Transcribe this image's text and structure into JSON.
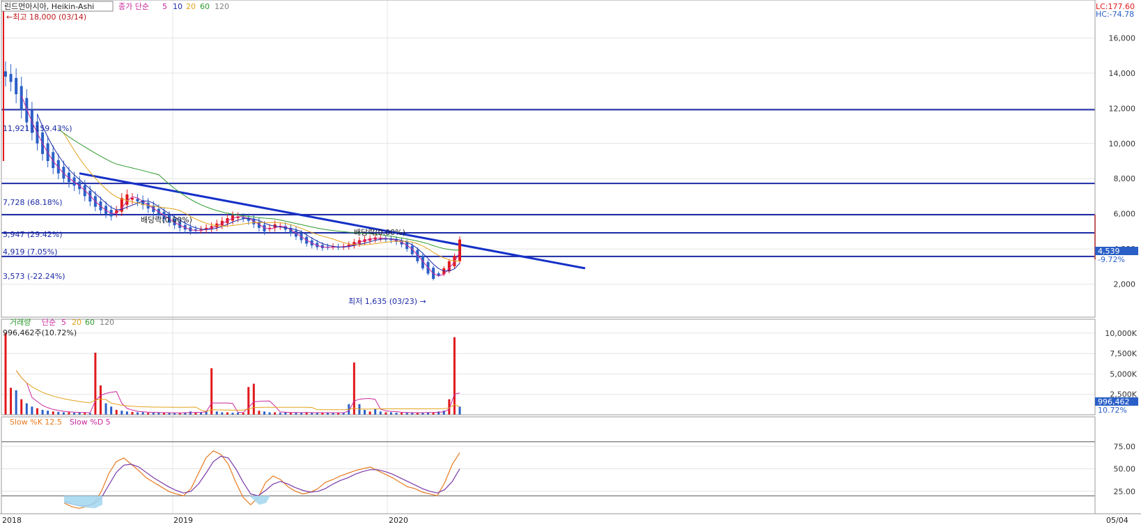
{
  "price_panel": {
    "title": "린드먼아시아, Heikin-Ashi",
    "ma_prefix": "종가 단순",
    "ma_periods": [
      "5",
      "10",
      "20",
      "60",
      "120"
    ],
    "lc_label": "LC:177.60",
    "hc_label": "HC:-74.78",
    "high_note": "←최고 18,000 (03/14)",
    "low_note": "최저 1,635 (03/23) →",
    "dividend_labels": [
      "배당락(0.00%)",
      "배당락(0.00%)"
    ],
    "current_price": "4,539",
    "current_change": "-9.72%",
    "level_labels": [
      {
        "value": 11921,
        "label": "11,921 (159.43%)"
      },
      {
        "value": 7728,
        "label": "7,728 (68.18%)"
      },
      {
        "value": 5947,
        "label": "5,947 (29.42%)"
      },
      {
        "value": 4919,
        "label": "4,919 (7.05%)"
      },
      {
        "value": 3573,
        "label": "3,573 (-22.24%)"
      }
    ]
  },
  "volume_panel": {
    "title": "거래량",
    "ma_prefix": "단순",
    "ma_periods": [
      "5",
      "20",
      "60",
      "120"
    ],
    "current_label": "996,462주(10.72%)",
    "right_value": "996,462",
    "right_pct": "10.72%"
  },
  "stoch_panel": {
    "title_k": "Slow %K 12.5",
    "title_d": "Slow %D 5"
  },
  "x_axis": {
    "labels": [
      "2018",
      "2019",
      "2020"
    ],
    "right_label": "05/04"
  },
  "colors": {
    "up": "#e0191c",
    "down": "#2a5fc7",
    "level": "#1c2aa6",
    "trend": "#1530c8",
    "ma5": "#c8289c",
    "ma10": "#1c2aa6",
    "ma20": "#e3a21a",
    "ma60": "#2e9a2e",
    "ma120": "#7f7f7f",
    "slow_k": "#e77a1e",
    "slow_d": "#7a3aa8",
    "oversold_fill": "#a7d8f0"
  },
  "chart_data": [
    {
      "type": "candlestick",
      "title": "린드먼아시아, Heikin-Ashi",
      "yticks": [
        2000,
        4000,
        6000,
        8000,
        10000,
        12000,
        14000,
        16000
      ],
      "ytick_labels": [
        "2,000",
        "4,000",
        "6,000",
        "8,000",
        "10,000",
        "12,000",
        "14,000",
        "16,000"
      ],
      "ylim": [
        200,
        18000
      ],
      "horizontal_levels": [
        11921,
        7728,
        5947,
        4919,
        3573
      ],
      "trendline": {
        "start": {
          "date": "2018-08",
          "value": 8300
        },
        "end": {
          "date": "2020-06",
          "value": 2900
        }
      },
      "high": {
        "value": 18000,
        "date": "03/14"
      },
      "low": {
        "value": 1635,
        "date": "03/23"
      },
      "close_approx": [
        13800,
        13500,
        12800,
        11900,
        11200,
        10600,
        10000,
        9400,
        9000,
        8600,
        8300,
        8000,
        7800,
        7600,
        7400,
        7000,
        6700,
        6400,
        6200,
        6000,
        5850,
        6200,
        6900,
        7100,
        6900,
        6700,
        6500,
        6300,
        6100,
        5950,
        5700,
        5500,
        5350,
        5200,
        5100,
        5000,
        5050,
        5100,
        5200,
        5300,
        5450,
        5600,
        5750,
        5900,
        5850,
        5750,
        5600,
        5400,
        5200,
        5000,
        5200,
        5400,
        5300,
        5100,
        4900,
        4700,
        4500,
        4300,
        4200,
        4100,
        4050,
        4100,
        4150,
        4100,
        4150,
        4250,
        4400,
        4500,
        4550,
        4600,
        4650,
        4600,
        4550,
        4500,
        4400,
        4250,
        4000,
        3700,
        3300,
        2900,
        2600,
        2300,
        2500,
        2900,
        3300,
        3600,
        4539
      ]
    },
    {
      "type": "bar",
      "title": "거래량",
      "yticks": [
        2500,
        5000,
        7500,
        10000
      ],
      "ytick_labels": [
        "2,500K",
        "5,000K",
        "7,500K",
        "10,000K"
      ],
      "ylim": [
        0,
        10500
      ],
      "values_k_approx": [
        10000,
        3300,
        3000,
        1900,
        1400,
        1000,
        800,
        600,
        500,
        400,
        350,
        300,
        300,
        250,
        250,
        250,
        200,
        7600,
        3600,
        1400,
        1000,
        600,
        500,
        400,
        350,
        300,
        300,
        250,
        250,
        250,
        250,
        250,
        200,
        200,
        300,
        400,
        300,
        300,
        500,
        5700,
        400,
        300,
        300,
        250,
        250,
        250,
        3400,
        3800,
        500,
        400,
        300,
        300,
        250,
        300,
        250,
        250,
        250,
        300,
        250,
        250,
        250,
        250,
        250,
        250,
        250,
        1300,
        6400,
        1300,
        600,
        400,
        700,
        400,
        300,
        300,
        250,
        250,
        250,
        250,
        250,
        300,
        300,
        300,
        400,
        500,
        1900,
        9500,
        996
      ]
    },
    {
      "type": "line",
      "title": "Slow %K 12.5  Slow %D 5",
      "yticks": [
        25,
        50,
        75
      ],
      "ytick_labels": [
        "25.00",
        "50.00",
        "75.00"
      ],
      "ylim": [
        0,
        100
      ],
      "series": [
        {
          "name": "Slow %K 12.5",
          "values": [
            12,
            8,
            6,
            8,
            12,
            25,
            45,
            58,
            62,
            55,
            48,
            40,
            35,
            30,
            25,
            22,
            20,
            28,
            45,
            62,
            70,
            66,
            55,
            35,
            18,
            10,
            18,
            35,
            42,
            38,
            30,
            25,
            22,
            24,
            28,
            35,
            38,
            42,
            45,
            48,
            50,
            52,
            48,
            44,
            40,
            35,
            30,
            28,
            24,
            22,
            20,
            35,
            55,
            68
          ]
        },
        {
          "name": "Slow %D 5",
          "values": [
            14,
            11,
            9,
            9,
            11,
            18,
            32,
            46,
            54,
            55,
            52,
            46,
            40,
            35,
            30,
            26,
            23,
            25,
            33,
            45,
            58,
            64,
            62,
            50,
            35,
            22,
            20,
            26,
            33,
            36,
            33,
            29,
            26,
            24,
            25,
            28,
            33,
            37,
            40,
            44,
            47,
            49,
            49,
            47,
            44,
            40,
            36,
            32,
            28,
            25,
            23,
            27,
            36,
            50
          ]
        }
      ],
      "reference_lines": [
        20,
        80
      ]
    }
  ]
}
